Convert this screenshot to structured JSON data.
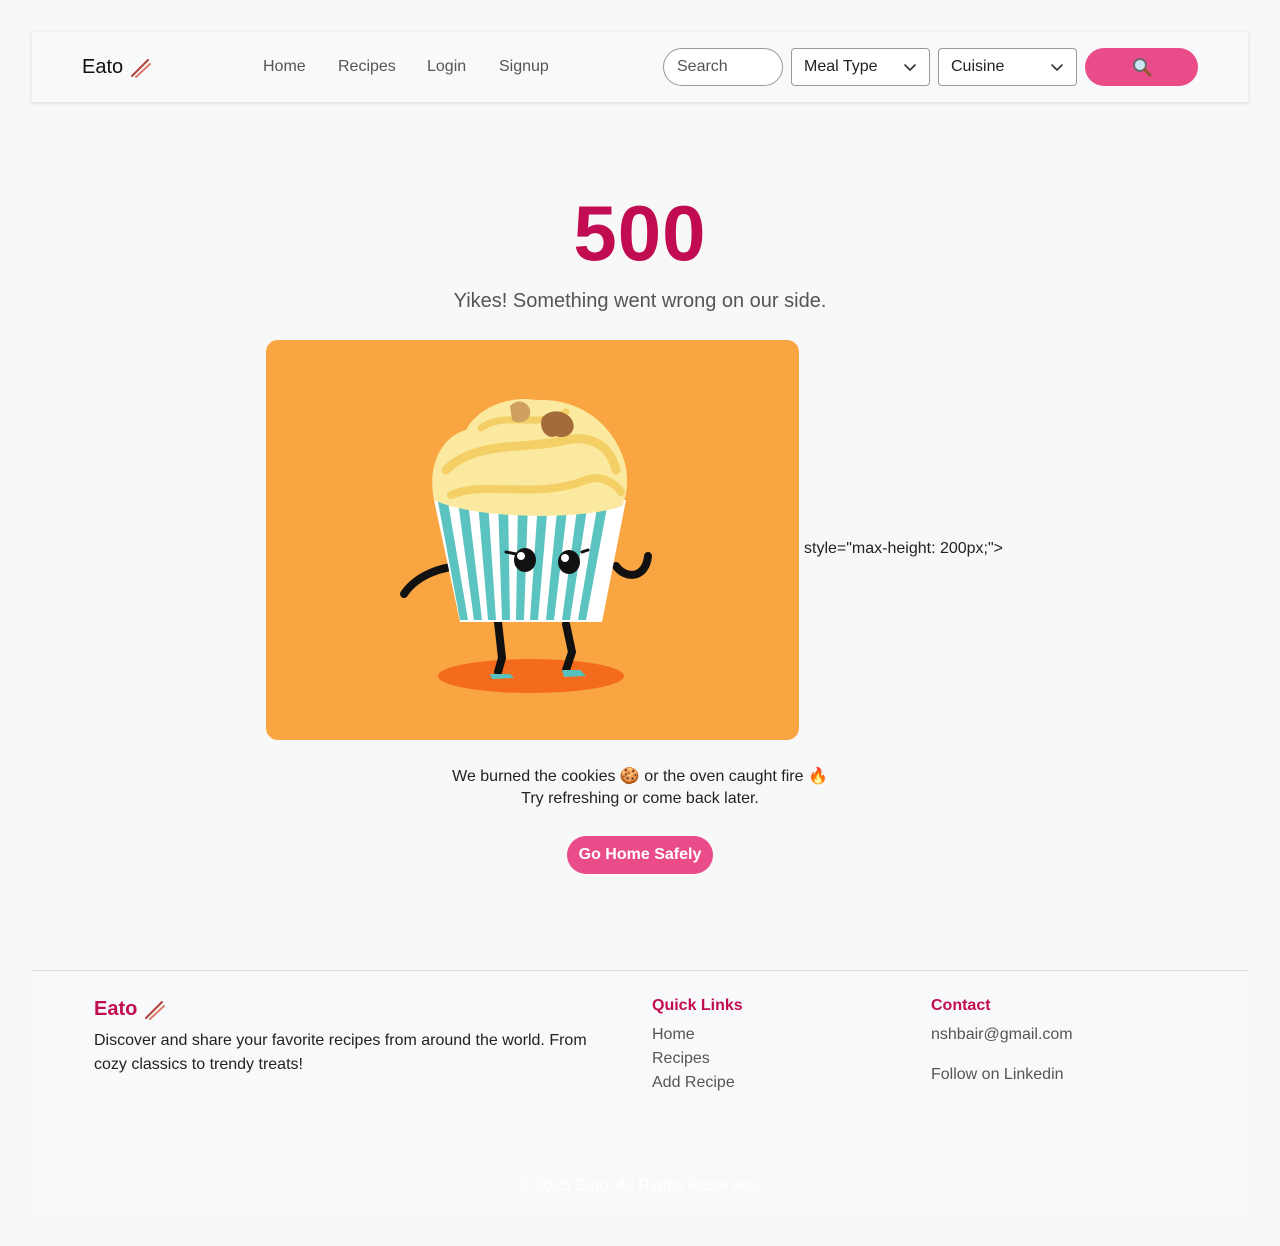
{
  "navbar": {
    "brand": "Eato",
    "brand_icon": "chopsticks-icon",
    "links": [
      "Home",
      "Recipes",
      "Login",
      "Signup"
    ],
    "search_placeholder": "Search",
    "meal_type_label": "Meal Type",
    "cuisine_label": "Cuisine",
    "search_button_icon": "magnifier-icon",
    "accent_color": "#ea4c89"
  },
  "error": {
    "code": "500",
    "message": "Yikes! Something went wrong on our side.",
    "illustration": "dancing-cupcake",
    "stray_text": "style=\"max-height: 200px;\">",
    "line1": "We burned the cookies 🍪 or the oven caught fire 🔥",
    "line2": "Try refreshing or come back later.",
    "button": "Go Home Safely",
    "code_color": "#c20c52"
  },
  "footer": {
    "brand": "Eato",
    "description": "Discover and share your favorite recipes from around the world. From cozy classics to trendy treats!",
    "quick_links_title": "Quick Links",
    "quick_links": [
      "Home",
      "Recipes",
      "Add Recipe"
    ],
    "contact_title": "Contact",
    "email": "nshbair@gmail.com",
    "linkedin": "Follow on Linkedin",
    "copyright": "© 2025 Eato. All Rights Reserved."
  }
}
